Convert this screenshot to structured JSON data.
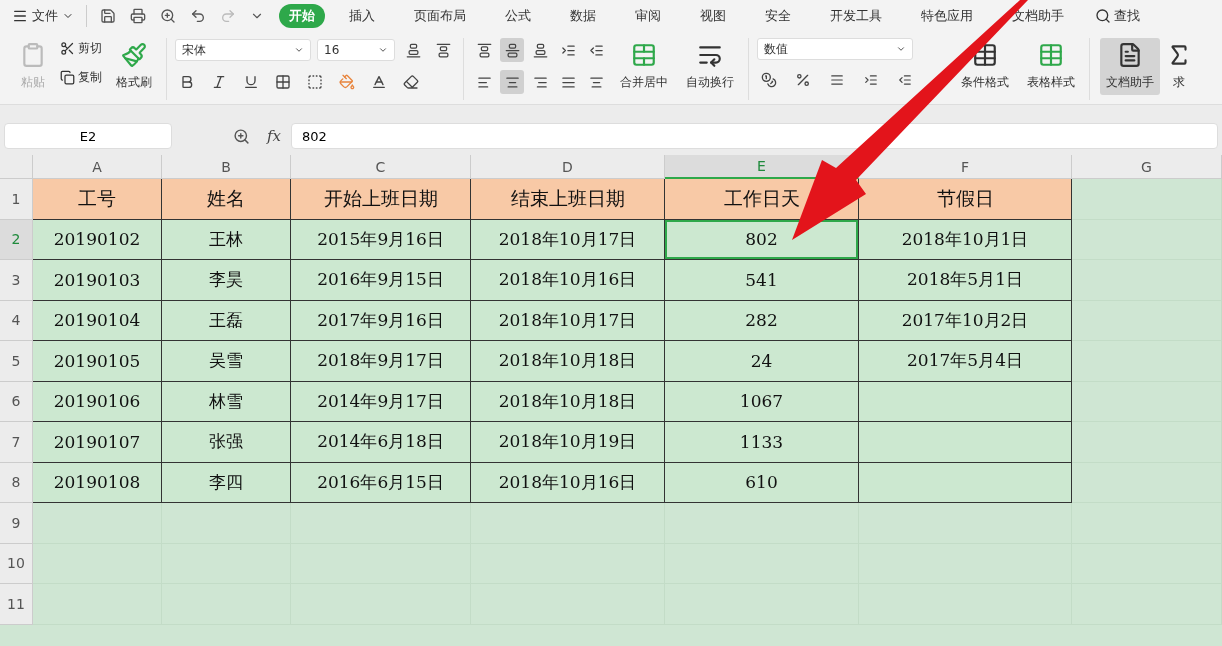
{
  "menu": {
    "label": "文件"
  },
  "tabs": [
    {
      "label": "开始",
      "selected": true
    },
    {
      "label": "插入",
      "selected": false
    },
    {
      "label": "页面布局",
      "selected": false
    },
    {
      "label": "公式",
      "selected": false
    },
    {
      "label": "数据",
      "selected": false
    },
    {
      "label": "审阅",
      "selected": false
    },
    {
      "label": "视图",
      "selected": false
    },
    {
      "label": "安全",
      "selected": false
    },
    {
      "label": "开发工具",
      "selected": false
    },
    {
      "label": "特色应用",
      "selected": false
    },
    {
      "label": "文档助手",
      "selected": false
    }
  ],
  "search": {
    "label": "查找"
  },
  "ribbon": {
    "paste": "粘贴",
    "cut": "剪切",
    "copy": "复制",
    "format_painter": "格式刷",
    "font": "宋体",
    "size": "16",
    "merge": "合并居中",
    "wrap": "自动换行",
    "number_format": "数值",
    "conditional": "条件格式",
    "table_style": "表格样式",
    "doc_helper": {
      "label": "文档助手",
      "selected": true
    },
    "sum": "求",
    "align_top_row": [
      {
        "selected": false
      },
      {
        "selected": true
      },
      {
        "selected": false
      },
      {
        "selected": false
      },
      {
        "selected": false
      }
    ],
    "align_bottom_row": [
      {
        "selected": false
      },
      {
        "selected": true
      },
      {
        "selected": false
      },
      {
        "selected": false
      },
      {
        "selected": false
      }
    ]
  },
  "name_box": "E2",
  "function_label": "fx",
  "formula": "802",
  "columns": [
    {
      "label": "A",
      "selected": false
    },
    {
      "label": "B",
      "selected": false
    },
    {
      "label": "C",
      "selected": false
    },
    {
      "label": "D",
      "selected": false
    },
    {
      "label": "E",
      "selected": true
    },
    {
      "label": "F",
      "selected": false
    },
    {
      "label": "G",
      "selected": false
    }
  ],
  "rows": [
    {
      "label": "1",
      "selected": false,
      "kind": "header",
      "cells": [
        {
          "text": "工号",
          "selected": false
        },
        {
          "text": "姓名",
          "selected": false
        },
        {
          "text": "开始上班日期",
          "selected": false
        },
        {
          "text": "结束上班日期",
          "selected": false
        },
        {
          "text": "工作日天",
          "selected": false
        },
        {
          "text": "节假日",
          "selected": false
        }
      ]
    },
    {
      "label": "2",
      "selected": true,
      "kind": "data",
      "cells": [
        {
          "text": "20190102",
          "selected": false
        },
        {
          "text": "王林",
          "selected": false
        },
        {
          "text": "2015年9月16日",
          "selected": false
        },
        {
          "text": "2018年10月17日",
          "selected": false
        },
        {
          "text": "802",
          "selected": true
        },
        {
          "text": "2018年10月1日",
          "selected": false
        }
      ]
    },
    {
      "label": "3",
      "selected": false,
      "kind": "data",
      "cells": [
        {
          "text": "20190103",
          "selected": false
        },
        {
          "text": "李昊",
          "selected": false
        },
        {
          "text": "2016年9月15日",
          "selected": false
        },
        {
          "text": "2018年10月16日",
          "selected": false
        },
        {
          "text": "541",
          "selected": false
        },
        {
          "text": "2018年5月1日",
          "selected": false
        }
      ]
    },
    {
      "label": "4",
      "selected": false,
      "kind": "data",
      "cells": [
        {
          "text": "20190104",
          "selected": false
        },
        {
          "text": "王磊",
          "selected": false
        },
        {
          "text": "2017年9月16日",
          "selected": false
        },
        {
          "text": "2018年10月17日",
          "selected": false
        },
        {
          "text": "282",
          "selected": false
        },
        {
          "text": "2017年10月2日",
          "selected": false
        }
      ]
    },
    {
      "label": "5",
      "selected": false,
      "kind": "data",
      "cells": [
        {
          "text": "20190105",
          "selected": false
        },
        {
          "text": "吴雪",
          "selected": false
        },
        {
          "text": "2018年9月17日",
          "selected": false
        },
        {
          "text": "2018年10月18日",
          "selected": false
        },
        {
          "text": "24",
          "selected": false
        },
        {
          "text": "2017年5月4日",
          "selected": false
        }
      ]
    },
    {
      "label": "6",
      "selected": false,
      "kind": "data",
      "cells": [
        {
          "text": "20190106",
          "selected": false
        },
        {
          "text": "林雪",
          "selected": false
        },
        {
          "text": "2014年9月17日",
          "selected": false
        },
        {
          "text": "2018年10月18日",
          "selected": false
        },
        {
          "text": "1067",
          "selected": false
        },
        {
          "selected": false
        }
      ]
    },
    {
      "label": "7",
      "selected": false,
      "kind": "data",
      "cells": [
        {
          "text": "20190107",
          "selected": false
        },
        {
          "text": "张强",
          "selected": false
        },
        {
          "text": "2014年6月18日",
          "selected": false
        },
        {
          "text": "2018年10月19日",
          "selected": false
        },
        {
          "text": "1133",
          "selected": false
        },
        {
          "selected": false
        }
      ]
    },
    {
      "label": "8",
      "selected": false,
      "kind": "data",
      "cells": [
        {
          "text": "20190108",
          "selected": false
        },
        {
          "text": "李四",
          "selected": false
        },
        {
          "text": "2016年6月15日",
          "selected": false
        },
        {
          "text": "2018年10月16日",
          "selected": false
        },
        {
          "text": "610",
          "selected": false
        },
        {
          "selected": false
        }
      ]
    },
    {
      "label": "9",
      "selected": false,
      "kind": "empty",
      "cells": []
    },
    {
      "label": "10",
      "selected": false,
      "kind": "empty",
      "cells": []
    },
    {
      "label": "11",
      "selected": false,
      "kind": "empty",
      "cells": []
    }
  ]
}
